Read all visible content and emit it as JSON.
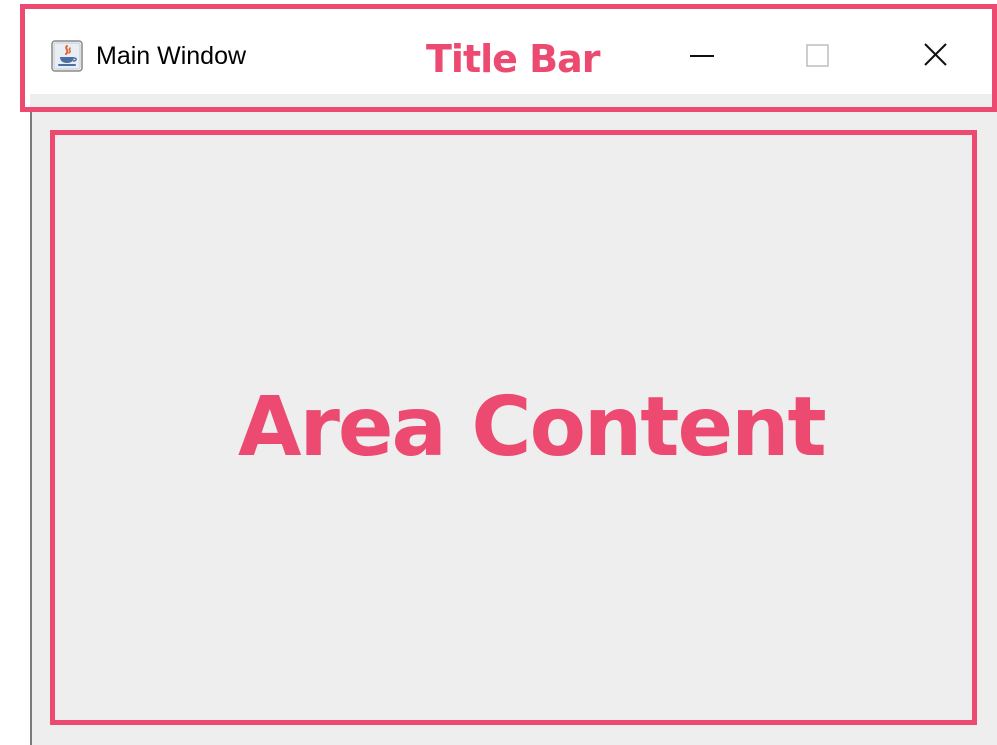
{
  "window": {
    "title": "Main Window",
    "icon": "java-cup-icon"
  },
  "caption_buttons": {
    "minimize": "minimize-icon",
    "maximize": "maximize-icon",
    "close": "close-icon"
  },
  "annotations": {
    "title_bar_label": "Title Bar",
    "content_label": "Area Content",
    "color": "#ec4a70"
  },
  "colors": {
    "titlebar_bg": "#ffffff",
    "content_bg": "#eeeeee"
  }
}
